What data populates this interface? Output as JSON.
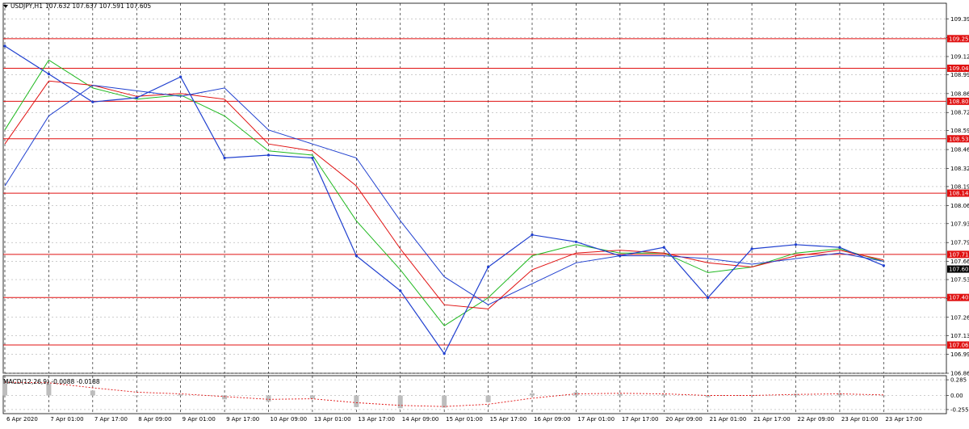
{
  "header": {
    "symbol_label": "USDJPY,H1",
    "ohlc_text": "107.632 107.637 107.591 107.605"
  },
  "macd_header": {
    "label": "MACD(12,26,9)",
    "values_text": "-0.0088 -0.0188"
  },
  "colors": {
    "price": "#1f3fcf",
    "ma_fast": "#1fb81f",
    "ma_mid": "#e01010",
    "ma_slow": "#1f3fcf",
    "level_line": "#e01010",
    "level_tag_bg": "#e01010",
    "current_tag_bg": "#000000",
    "grid": "#9a9a9a",
    "macd_hist": "#bdbdbd",
    "macd_signal": "#e01010"
  },
  "icons": {
    "symbol_menu": "triangle-down-icon"
  },
  "chart_data": [
    {
      "type": "line",
      "title": "USDJPY,H1",
      "x": [
        "6 Apr 2020",
        "7 Apr 01:00",
        "7 Apr 17:00",
        "8 Apr 09:00",
        "9 Apr 01:00",
        "9 Apr 17:00",
        "10 Apr 09:00",
        "13 Apr 01:00",
        "13 Apr 17:00",
        "14 Apr 09:00",
        "15 Apr 01:00",
        "15 Apr 17:00",
        "16 Apr 09:00",
        "17 Apr 01:00",
        "17 Apr 17:00",
        "20 Apr 09:00",
        "21 Apr 01:00",
        "21 Apr 17:00",
        "22 Apr 09:00",
        "23 Apr 01:00",
        "23 Apr 17:00"
      ],
      "series": [
        {
          "values": [
            109.2,
            109.0,
            108.8,
            108.83,
            108.98,
            108.4,
            108.42,
            108.4,
            107.7,
            107.45,
            107.0,
            107.62,
            107.85,
            107.8,
            107.7,
            107.76,
            107.4,
            107.75,
            107.78,
            107.76,
            107.63
          ]
        },
        {
          "values": [
            108.6,
            109.1,
            108.9,
            108.82,
            108.85,
            108.7,
            108.45,
            108.42,
            107.95,
            107.6,
            107.2,
            107.4,
            107.7,
            107.78,
            107.72,
            107.72,
            107.58,
            107.62,
            107.72,
            107.75,
            107.66
          ]
        },
        {
          "values": [
            108.5,
            108.95,
            108.92,
            108.84,
            108.86,
            108.82,
            108.5,
            108.45,
            108.2,
            107.75,
            107.35,
            107.32,
            107.6,
            107.72,
            107.74,
            107.72,
            107.65,
            107.62,
            107.7,
            107.74,
            107.67
          ]
        },
        {
          "values": [
            108.2,
            108.7,
            108.92,
            108.88,
            108.84,
            108.9,
            108.6,
            108.5,
            108.4,
            107.95,
            107.55,
            107.35,
            107.5,
            107.65,
            107.7,
            107.7,
            107.68,
            107.64,
            107.68,
            107.72,
            107.66
          ]
        }
      ],
      "y_ticks": [
        "109.395",
        "109.260",
        "109.125",
        "108.995",
        "108.860",
        "108.725",
        "108.595",
        "108.460",
        "108.325",
        "108.195",
        "108.060",
        "107.930",
        "107.795",
        "107.660",
        "107.530",
        "107.395",
        "107.260",
        "107.130",
        "106.995",
        "106.860"
      ],
      "ylim": [
        106.86,
        109.46
      ],
      "current_price": "107.605",
      "horizontal_levels": [
        "109.253",
        "109.041",
        "108.805",
        "108.537",
        "108.148",
        "107.710",
        "107.402",
        "107.062"
      ],
      "grid": true,
      "legend": "none"
    },
    {
      "type": "bar",
      "title": "MACD(12,26,9)",
      "y_ticks": [
        "0.285",
        "0.00",
        "-0.255"
      ],
      "ylim": [
        -0.3,
        0.33
      ],
      "values": [
        0.28,
        0.22,
        0.09,
        0.0,
        0.02,
        -0.07,
        -0.11,
        -0.06,
        -0.21,
        -0.23,
        -0.22,
        -0.12,
        0.04,
        0.06,
        0.03,
        0.02,
        -0.03,
        0.01,
        0.03,
        0.04,
        -0.01
      ],
      "signal": [
        0.24,
        0.23,
        0.14,
        0.06,
        0.03,
        -0.02,
        -0.07,
        -0.06,
        -0.13,
        -0.18,
        -0.2,
        -0.16,
        -0.05,
        0.03,
        0.04,
        0.03,
        0.0,
        0.0,
        0.02,
        0.03,
        0.01
      ],
      "grid": true
    }
  ]
}
